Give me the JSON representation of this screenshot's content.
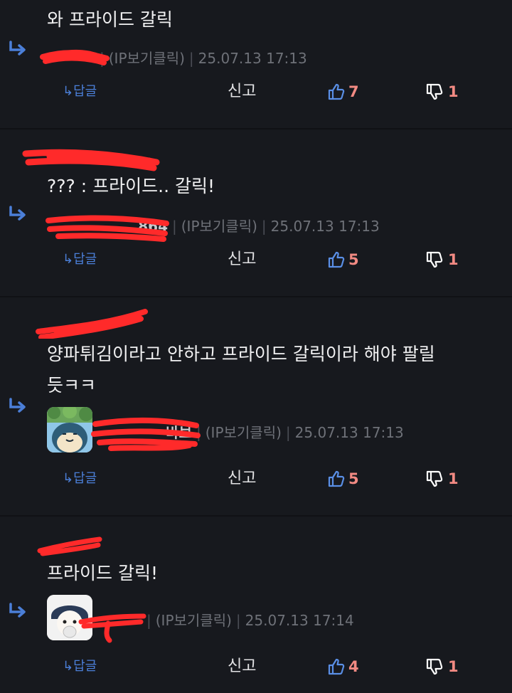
{
  "colors": {
    "background": "#17191e",
    "accent_blue": "#4b7fd8",
    "count_red": "#f28a83",
    "scribble": "#ff2a2a"
  },
  "comments": [
    {
      "text": "와 프라이드 갈릭",
      "nick": "",
      "ip_label": "(IP보기클릭)",
      "timestamp": "25.07.13 17:13",
      "reply_label": "↳답글",
      "report_label": "신고",
      "likes": "7",
      "dislikes": "1"
    },
    {
      "top_name": "",
      "text": "??? : 프라이드.. 갈릭!",
      "nick": "864",
      "ip_label": "(IP보기클릭)",
      "timestamp": "25.07.13 17:13",
      "reply_label": "↳답글",
      "report_label": "신고",
      "likes": "5",
      "dislikes": "1"
    },
    {
      "top_name": "",
      "text_line1": "양파튀김이라고 안하고 프라이드 갈릭이라 해야 팔릴",
      "text_line2": "듯ㅋㅋ",
      "nick": "바보",
      "ip_label": "(IP보기클릭)",
      "timestamp": "25.07.13 17:13",
      "reply_label": "↳답글",
      "report_label": "신고",
      "likes": "5",
      "dislikes": "1"
    },
    {
      "top_name": "",
      "text": "프라이드 갈릭!",
      "nick": "",
      "ip_label": "(IP보기클릭)",
      "timestamp": "25.07.13 17:14",
      "reply_label": "↳답글",
      "report_label": "신고",
      "likes": "4",
      "dislikes": "1"
    }
  ]
}
